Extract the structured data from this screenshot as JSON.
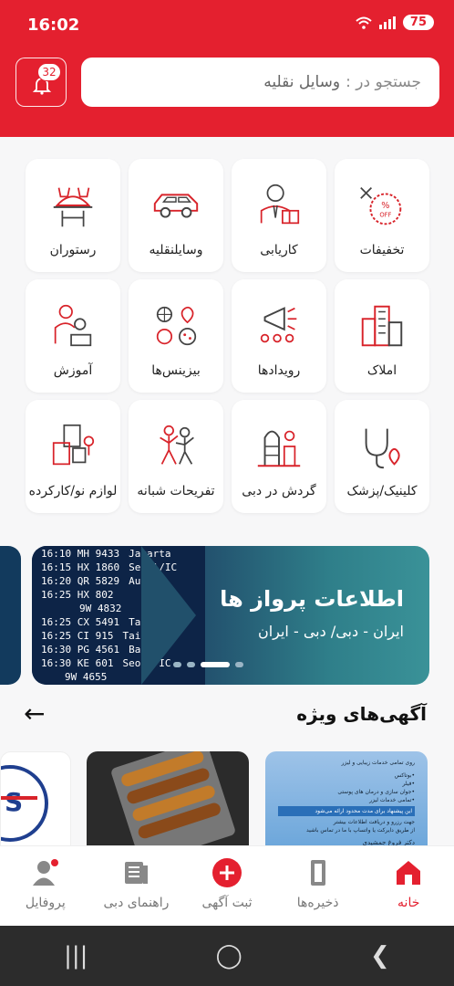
{
  "status": {
    "time": "16:02",
    "battery": "75"
  },
  "header": {
    "notification_count": "32",
    "search_placeholder": "جستجو در :",
    "search_scope": "وسایل نقلیه"
  },
  "categories": [
    {
      "label": "تخفیفات",
      "icon": "discount-icon"
    },
    {
      "label": "کاریابی",
      "icon": "job-icon"
    },
    {
      "label": "وسایلنقلیه",
      "icon": "car-icon"
    },
    {
      "label": "رستوران",
      "icon": "restaurant-icon"
    },
    {
      "label": "املاک",
      "icon": "buildings-icon"
    },
    {
      "label": "رویدادها",
      "icon": "events-icon"
    },
    {
      "label": "بیزینس‌ها",
      "icon": "business-icon"
    },
    {
      "label": "آموزش",
      "icon": "education-icon"
    },
    {
      "label": "کلینیک/پزشک",
      "icon": "clinic-icon"
    },
    {
      "label": "گردش در دبی",
      "icon": "dubai-tour-icon"
    },
    {
      "label": "تفریحات شبانه",
      "icon": "nightlife-icon"
    },
    {
      "label": "لوازم نو/کارکرده",
      "icon": "goods-icon"
    }
  ],
  "banner": {
    "title": "اطلاعات پرواز ها",
    "subtitle": "ایران - دبی/ دبی - ایران",
    "board_rows": [
      {
        "time": "16:10",
        "flight": "MH 9433",
        "city": "Jakarta"
      },
      {
        "time": "16:15",
        "flight": "HX 1860",
        "city": "Seoul/IC"
      },
      {
        "time": "16:20",
        "flight": "QR 5829",
        "city": "Auckla"
      },
      {
        "time": "16:25",
        "flight": "HX 802",
        "city": ""
      },
      {
        "time": "",
        "flight": "9W 4832",
        "city": ""
      },
      {
        "time": "16:25",
        "flight": "CX 5491",
        "city": "Ta"
      },
      {
        "time": "16:25",
        "flight": "CI 915",
        "city": "Taipei"
      },
      {
        "time": "16:30",
        "flight": "PG 4561",
        "city": "Bangko"
      },
      {
        "time": "16:30",
        "flight": "KE 601",
        "city": "Seoul/IC"
      },
      {
        "time": "",
        "flight": "9W 4655",
        "city": ""
      }
    ]
  },
  "featured": {
    "title": "آگهی‌های ویژه",
    "ad1_lines": [
      "روی تمامی خدمات زیبایی و لیزر",
      "•بوتاکس",
      "•فیلر",
      "•جوان سازی و درمان های پوستی",
      "•تمامی خدمات لیزر",
      "این پیشنهاد برای مدت محدود ارائه می‌شود",
      "جهت رزرو و دریافت اطلاعات بیشتر",
      "از طریق دایرکت یا واتساپ با ما در تماس باشید",
      "دکتر فروغ جمشیدی"
    ]
  },
  "nav": [
    {
      "label": "خانه",
      "icon": "home-icon"
    },
    {
      "label": "ذخیره‌ها",
      "icon": "bookmark-icon"
    },
    {
      "label": "ثبت آگهی",
      "icon": "add-icon"
    },
    {
      "label": "راهنمای دبی",
      "icon": "guide-icon"
    },
    {
      "label": "پروفایل",
      "icon": "profile-icon"
    }
  ],
  "colors": {
    "brand": "#e4202f",
    "banner": "#2f7f8a"
  }
}
